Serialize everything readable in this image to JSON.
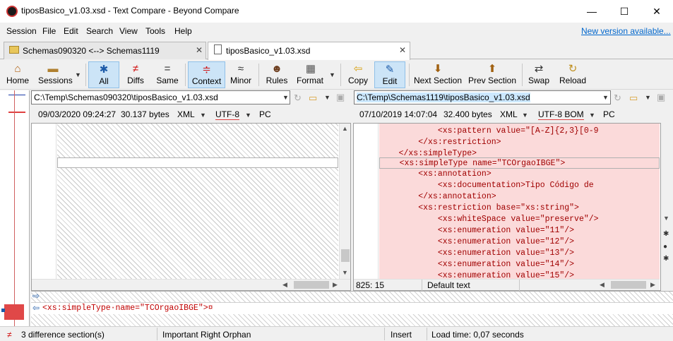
{
  "window": {
    "title": "tiposBasico_v1.03.xsd - Text Compare - Beyond Compare",
    "minimize": "—",
    "maximize": "☐",
    "close": "✕"
  },
  "menu": {
    "items": [
      "Session",
      "File",
      "Edit",
      "Search",
      "View",
      "Tools",
      "Help"
    ],
    "new_version": "New version available..."
  },
  "tabs": [
    {
      "label": "Schemas090320 <--> Schemas1119",
      "close": "✕",
      "icon": "folder-icon"
    },
    {
      "label": "tiposBasico_v1.03.xsd",
      "close": "✕",
      "icon": "document-icon"
    }
  ],
  "toolbar": {
    "home": {
      "label": "Home",
      "icon": "⌂"
    },
    "sessions": {
      "label": "Sessions",
      "icon": "▬"
    },
    "all": {
      "label": "All",
      "icon": "✱"
    },
    "diffs": {
      "label": "Diffs",
      "icon": "≠"
    },
    "same": {
      "label": "Same",
      "icon": "="
    },
    "context": {
      "label": "Context",
      "icon": "≑"
    },
    "minor": {
      "label": "Minor",
      "icon": "≈"
    },
    "rules": {
      "label": "Rules",
      "icon": "☻"
    },
    "format": {
      "label": "Format",
      "icon": "▦"
    },
    "copy": {
      "label": "Copy",
      "icon": "⇦"
    },
    "edit": {
      "label": "Edit",
      "icon": "✎"
    },
    "next_section": {
      "label": "Next Section",
      "icon": "⬇"
    },
    "prev_section": {
      "label": "Prev Section",
      "icon": "⬆"
    },
    "swap": {
      "label": "Swap",
      "icon": "⇄"
    },
    "reload": {
      "label": "Reload",
      "icon": "↻"
    }
  },
  "left": {
    "path": "C:\\Temp\\Schemas090320\\tiposBasico_v1.03.xsd",
    "date": "09/03/2020 09:24:27",
    "size": "30.137 bytes",
    "format": "XML",
    "encoding": "UTF-8",
    "line_ending": "PC"
  },
  "right": {
    "path": "C:\\Temp\\Schemas1119\\tiposBasico_v1.03.xsd",
    "date": "07/10/2019 14:07:04",
    "size": "32.400 bytes",
    "format": "XML",
    "encoding": "UTF-8 BOM",
    "line_ending": "PC",
    "lines": [
      "            <xs:pattern value=\"[A-Z]{2,3}[0-9",
      "        </xs:restriction>",
      "    </xs:simpleType>",
      "    <xs:simpleType name=\"TCOrgaoIBGE\">",
      "        <xs:annotation>",
      "            <xs:documentation>Tipo Código de",
      "        </xs:annotation>",
      "        <xs:restriction base=\"xs:string\">",
      "            <xs:whiteSpace value=\"preserve\"/>",
      "            <xs:enumeration value=\"11\"/>",
      "            <xs:enumeration value=\"12\"/>",
      "            <xs:enumeration value=\"13\"/>",
      "            <xs:enumeration value=\"14\"/>",
      "            <xs:enumeration value=\"15\"/>"
    ],
    "cursor_pos": "825: 15",
    "text_mode": "Default text"
  },
  "detail_line": "<xs:simpleType·name=\"TCOrgaoIBGE\">¤",
  "status": {
    "diff_sections": "3 difference section(s)",
    "orphan": "Important Right Orphan",
    "mode": "Insert",
    "load_time": "Load time: 0,07 seconds"
  }
}
